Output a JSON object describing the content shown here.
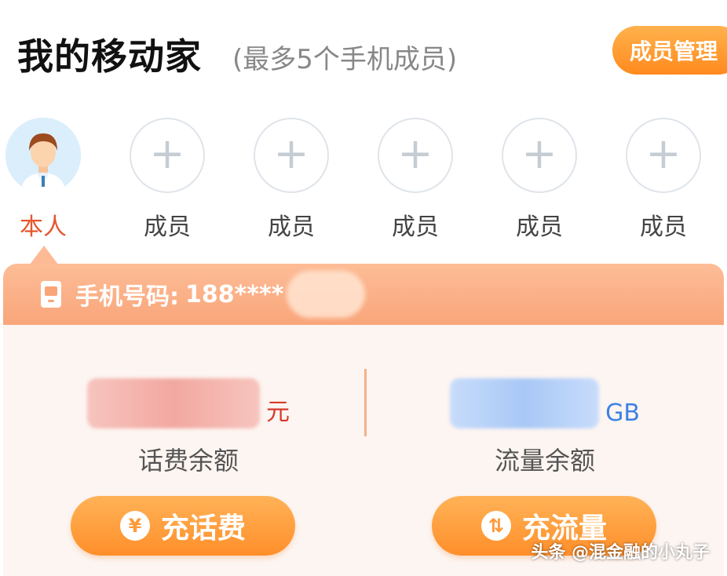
{
  "header": {
    "title": "我的移动家",
    "subtitle": "(最多5个手机成员)",
    "manage_label": "成员管理"
  },
  "members": [
    {
      "label": "本人",
      "type": "self"
    },
    {
      "label": "成员",
      "type": "add",
      "plus": "+"
    },
    {
      "label": "成员",
      "type": "add",
      "plus": "+"
    },
    {
      "label": "成员",
      "type": "add",
      "plus": "+"
    },
    {
      "label": "成员",
      "type": "add",
      "plus": "+"
    },
    {
      "label": "成员",
      "type": "add",
      "plus": "+"
    }
  ],
  "phone": {
    "label": "手机号码:",
    "number": "188****"
  },
  "balance": {
    "call_unit": "元",
    "call_label": "话费余额",
    "data_unit": "GB",
    "data_label": "流量余额"
  },
  "actions": {
    "recharge_call_icon": "¥",
    "recharge_call_label": "充话费",
    "recharge_data_icon": "⇅",
    "recharge_data_label": "充流量"
  },
  "watermark": "头条 @混金融的小丸子",
  "colors": {
    "accent_orange": "#ff8f2a",
    "phone_bar": "#f9a57a",
    "self_label": "#e6572e",
    "yuan_red": "#d8392b",
    "gb_blue": "#3b82e6"
  }
}
